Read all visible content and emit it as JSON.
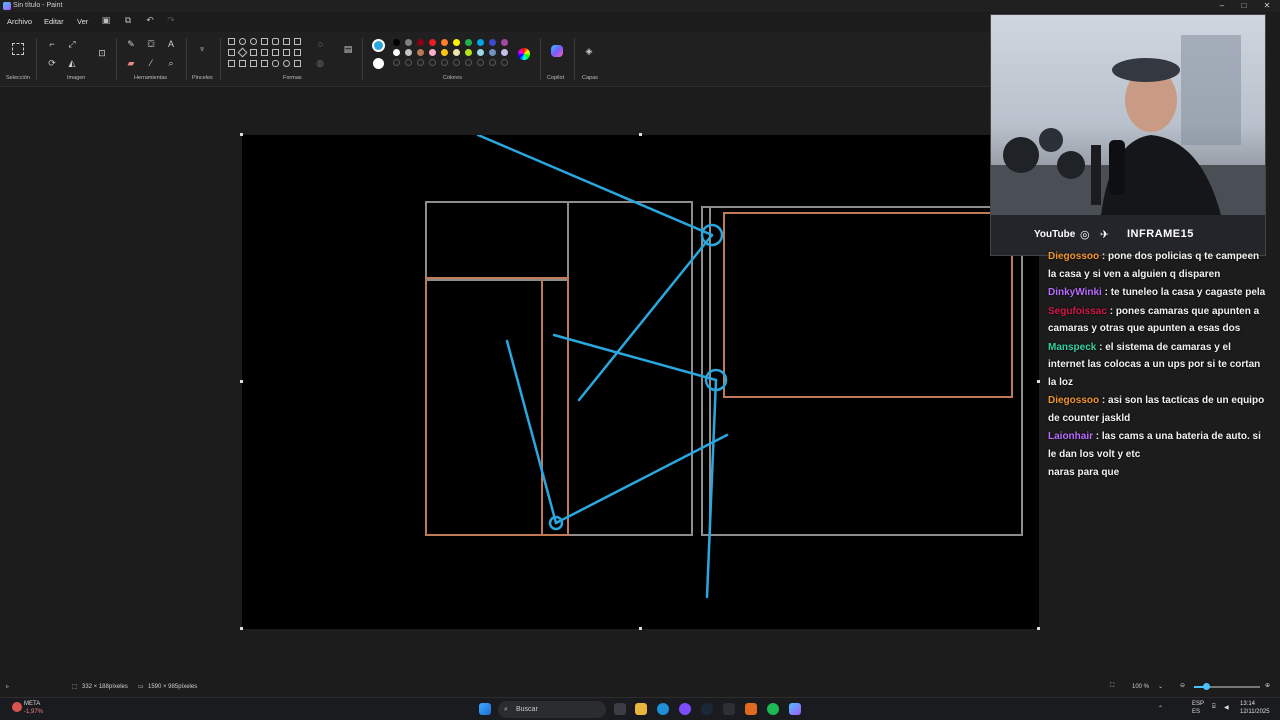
{
  "window": {
    "title": "Sin título - Paint"
  },
  "menu": {
    "archivo": "Archivo",
    "editar": "Editar",
    "ver": "Ver"
  },
  "ribbon": {
    "groups": {
      "seleccion": "Selección",
      "imagen": "Imagen",
      "herramientas": "Herramientas",
      "pinceles": "Pinceles",
      "formas": "Formas",
      "colores": "Colores",
      "copilot": "Copilot",
      "capas": "Capas"
    },
    "primary_color": "#29a8e0",
    "secondary_color": "#ffffff",
    "palette_row1": [
      "#000000",
      "#7f7f7f",
      "#880015",
      "#ed1c24",
      "#ff7f27",
      "#fff200",
      "#22b14c",
      "#00a2e8",
      "#3f48cc",
      "#a349a4"
    ],
    "palette_row2": [
      "#ffffff",
      "#c3c3c3",
      "#b97a57",
      "#ffaec9",
      "#ffc90e",
      "#efe4b0",
      "#b5e61d",
      "#99d9ea",
      "#7092be",
      "#c8bfe7"
    ]
  },
  "webcam": {
    "social_youtube": "YouTube",
    "channel": "INFRAME15"
  },
  "chat": [
    {
      "user": "Diegossoo",
      "color": "#f0962c",
      "text": "pone dos policias q te campeen la casa y si ven a alguien q disparen"
    },
    {
      "user": "DinkyWinki",
      "color": "#b76cff",
      "text": "te tuneleo la casa y cagaste pela"
    },
    {
      "user": "Segufoissac",
      "color": "#d4174a",
      "text": "pones camaras que apunten a camaras y otras que apunten a esas dos"
    },
    {
      "user": "Manspeck",
      "color": "#2fd3a0",
      "text": "el sistema de camaras y el internet las colocas a un ups por si te cortan la loz"
    },
    {
      "user": "Diegossoo",
      "color": "#f0962c",
      "text": "asi son las tacticas de un equipo de counter jaskld"
    },
    {
      "user": "Laionhair",
      "color": "#b76cff",
      "text": "las cams a una bateria de auto. si le dan los volt y etc"
    },
    {
      "user": "",
      "color": "#ffffff",
      "text": "naras para que"
    }
  ],
  "status": {
    "selection_size": "332 × 188píxeles",
    "canvas_size": "1590 × 985píxeles",
    "zoom": "100 %"
  },
  "taskbar": {
    "stock_name": "META",
    "stock_change": "-1,97%",
    "search_placeholder": "Buscar",
    "lang1": "ESP",
    "lang2": "ES",
    "time": "13:14",
    "date": "12/11/2025"
  }
}
